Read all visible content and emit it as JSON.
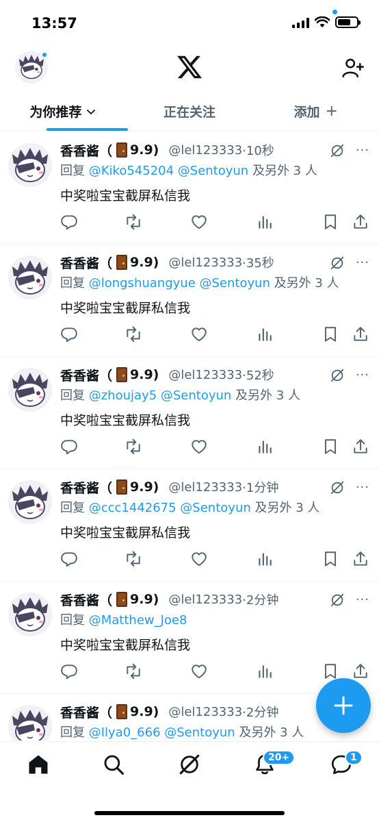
{
  "status_bar": {
    "time": "13:57"
  },
  "header": {
    "logo": "X",
    "avatar_icon": "avatar-pirate-cat",
    "add_user_icon": "person-plus-icon"
  },
  "tabs": [
    {
      "label": "为你推荐",
      "active": true
    },
    {
      "label": "正在关注",
      "active": false
    },
    {
      "label": "添加",
      "active": false
    }
  ],
  "tweets": [
    {
      "name": "香香酱（",
      "tag": "9.9)",
      "handle": "@lel123333",
      "time": "·10秒",
      "reply_prefix": "回复",
      "mentions": "@Kiko545204 @Sentoyun",
      "reply_suffix": " 及另外 3 人",
      "text": "中奖啦宝宝截屏私信我"
    },
    {
      "name": "香香酱（",
      "tag": "9.9)",
      "handle": "@lel123333",
      "time": "·35秒",
      "reply_prefix": "回复",
      "mentions": "@longshuangyue @Sentoyun",
      "reply_suffix": " 及另外 3 人",
      "text": "中奖啦宝宝截屏私信我"
    },
    {
      "name": "香香酱（",
      "tag": "9.9)",
      "handle": "@lel123333",
      "time": "·52秒",
      "reply_prefix": "回复",
      "mentions": "@zhoujay5 @Sentoyun",
      "reply_suffix": " 及另外 3 人",
      "text": "中奖啦宝宝截屏私信我"
    },
    {
      "name": "香香酱（",
      "tag": "9.9)",
      "handle": "@lel123333",
      "time": "·1分钟",
      "reply_prefix": "回复",
      "mentions": "@ccc1442675 @Sentoyun",
      "reply_suffix": " 及另外 3 人",
      "text": "中奖啦宝宝截屏私信我"
    },
    {
      "name": "香香酱（",
      "tag": "9.9)",
      "handle": "@lel123333",
      "time": "·2分钟",
      "reply_prefix": "回复",
      "mentions": "@Matthew_Joe8",
      "reply_suffix": "",
      "text": "中奖啦宝宝截屏私信我"
    },
    {
      "name": "香香酱（",
      "tag": "9.9)",
      "handle": "@lel123333",
      "time": "·2分钟",
      "reply_prefix": "回复",
      "mentions": "@Ilya0_666 @Sentoyun",
      "reply_suffix": " 及另外 3 人",
      "text": "中奖啦宝宝截屏私信我"
    }
  ],
  "bottom_nav": {
    "items": [
      "home-icon",
      "search-icon",
      "grok-icon",
      "notifications-icon",
      "messages-icon"
    ],
    "notifications_badge": "20+",
    "messages_badge": "1"
  },
  "fab": {
    "icon": "plus-icon"
  },
  "colors": {
    "accent": "#1d9bf0",
    "text": "#0f1419",
    "secondary": "#536471"
  }
}
